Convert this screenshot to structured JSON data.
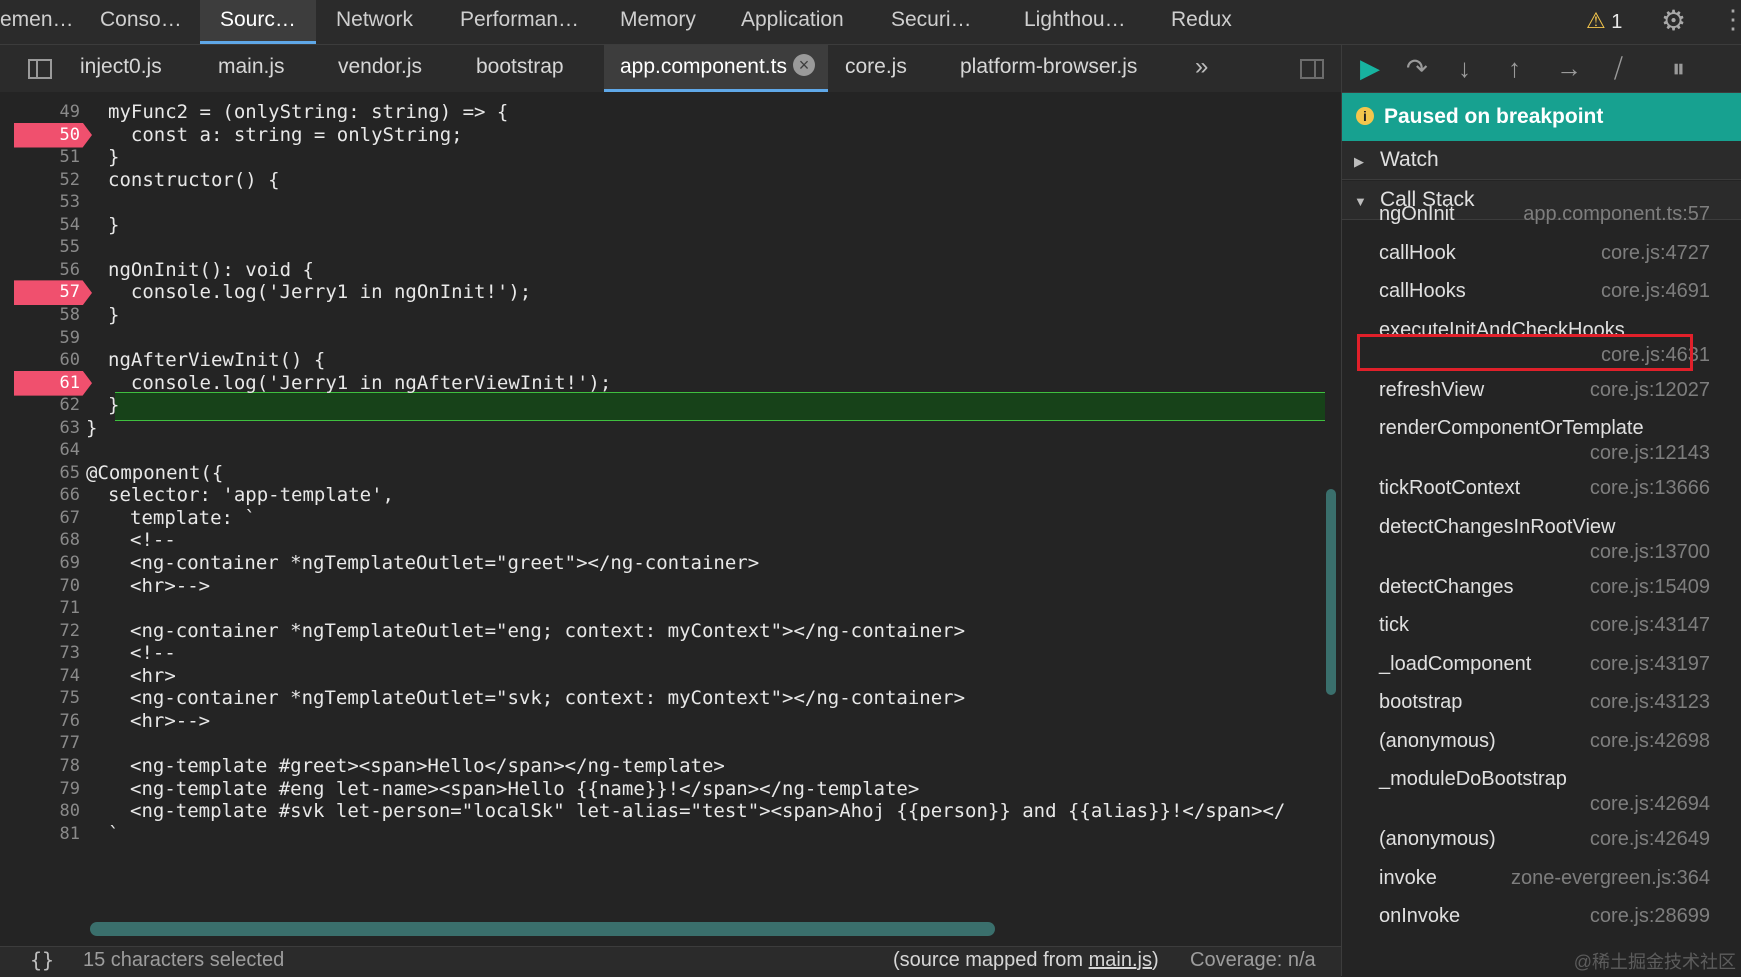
{
  "panel_tabs": [
    "emen…",
    "Conso…",
    "Sourc…",
    "Network",
    "Performan…",
    "Memory",
    "Application",
    "Securi…",
    "Lighthou…",
    "Redux"
  ],
  "active_panel": "Sourc…",
  "warnings_count": "1",
  "file_tabs": [
    "inject0.js",
    "main.js",
    "vendor.js",
    "bootstrap",
    "app.component.ts",
    "core.js",
    "platform-browser.js"
  ],
  "active_file": "app.component.ts",
  "more_tabs_label": "»",
  "code_lines": [
    {
      "n": "49",
      "text": "myFunc2 = (onlyString: string) => {"
    },
    {
      "n": "50",
      "text": "  const a: string = onlyString;"
    },
    {
      "n": "51",
      "text": "}"
    },
    {
      "n": "52",
      "text": "constructor() {"
    },
    {
      "n": "53",
      "text": ""
    },
    {
      "n": "54",
      "text": "}"
    },
    {
      "n": "55",
      "text": ""
    },
    {
      "n": "56",
      "text": "ngOnInit(): void {"
    },
    {
      "n": "57",
      "text": "  console.log('Jerry1 in ngOnInit!');"
    },
    {
      "n": "58",
      "text": "}"
    },
    {
      "n": "59",
      "text": ""
    },
    {
      "n": "60",
      "text": "ngAfterViewInit() {"
    },
    {
      "n": "61",
      "text": "  console.log('Jerry1 in ngAfterViewInit!');"
    },
    {
      "n": "62",
      "text": "}"
    },
    {
      "n": "63",
      "text": "}"
    },
    {
      "n": "64",
      "text": ""
    },
    {
      "n": "65",
      "text": "@Component({"
    },
    {
      "n": "66",
      "text": "selector: 'app-template',"
    },
    {
      "n": "67",
      "text": "template: `"
    },
    {
      "n": "68",
      "text": "<!--"
    },
    {
      "n": "69",
      "text": "<ng-container *ngTemplateOutlet=\"greet\"></ng-container>"
    },
    {
      "n": "70",
      "text": "<hr>-->"
    },
    {
      "n": "71",
      "text": ""
    },
    {
      "n": "72",
      "text": "<ng-container *ngTemplateOutlet=\"eng; context: myContext\"></ng-container>"
    },
    {
      "n": "73",
      "text": "<!--"
    },
    {
      "n": "74",
      "text": "<hr>"
    },
    {
      "n": "75",
      "text": "<ng-container *ngTemplateOutlet=\"svk; context: myContext\"></ng-container>"
    },
    {
      "n": "76",
      "text": "<hr>-->"
    },
    {
      "n": "77",
      "text": ""
    },
    {
      "n": "78",
      "text": "<ng-template #greet><span>Hello</span></ng-template>"
    },
    {
      "n": "79",
      "text": "<ng-template #eng let-name><span>Hello {{name}}!</span></ng-template>"
    },
    {
      "n": "80",
      "text": "<ng-template #svk let-person=\"localSk\" let-alias=\"test\"><span>Ahoj {{person}} and {{alias}}!</span></"
    },
    {
      "n": "81",
      "text": "`"
    }
  ],
  "breakpoint_lines": [
    "50",
    "57",
    "61"
  ],
  "current_line": "57",
  "status": {
    "braces": "{}",
    "selection": "15 characters selected",
    "mapped_prefix": "(source mapped from ",
    "mapped_file": "main.js",
    "mapped_suffix": ")",
    "coverage": "Coverage: n/a"
  },
  "debugger": {
    "paused_label": "Paused on breakpoint",
    "watch_label": "Watch",
    "callstack_label": "Call Stack",
    "frames": [
      {
        "name": "ngOnInit",
        "loc": "app.component.ts:57"
      },
      {
        "name": "callHook",
        "loc": "core.js:4727"
      },
      {
        "name": "callHooks",
        "loc": "core.js:4691"
      },
      {
        "name": "executeInitAndCheckHooks",
        "loc": "core.js:4631"
      },
      {
        "name": "refreshView",
        "loc": "core.js:12027"
      },
      {
        "name": "renderComponentOrTemplate",
        "loc": "core.js:12143"
      },
      {
        "name": "tickRootContext",
        "loc": "core.js:13666"
      },
      {
        "name": "detectChangesInRootView",
        "loc": "core.js:13700"
      },
      {
        "name": "detectChanges",
        "loc": "core.js:15409"
      },
      {
        "name": "tick",
        "loc": "core.js:43147"
      },
      {
        "name": "_loadComponent",
        "loc": "core.js:43197"
      },
      {
        "name": "bootstrap",
        "loc": "core.js:43123"
      },
      {
        "name": "(anonymous)",
        "loc": "core.js:42698"
      },
      {
        "name": "_moduleDoBootstrap",
        "loc": "core.js:42694"
      },
      {
        "name": "(anonymous)",
        "loc": "core.js:42649"
      },
      {
        "name": "invoke",
        "loc": "zone-evergreen.js:364"
      },
      {
        "name": "onInvoke",
        "loc": "core.js:28699"
      }
    ]
  },
  "watermark": "@稀土掘金技术社区",
  "colors": {
    "breakpoint": "#f0506e",
    "paused_bar": "#17a190",
    "exec_line": "#174219",
    "highlight_box": "#e0202a"
  }
}
